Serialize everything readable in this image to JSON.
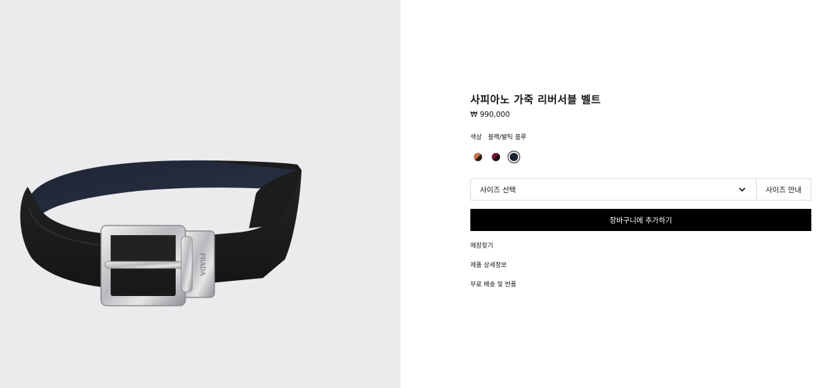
{
  "product": {
    "image_alt": "PRADA",
    "title": "사피아노 가죽 리버서블 벨트",
    "price": "₩ 990,000"
  },
  "color": {
    "label": "색상",
    "value": "블랙/발틱 블루",
    "swatches": [
      {
        "name": "brown-black",
        "color_a": "#c2744f",
        "color_b": "#2a1d1a",
        "selected": false
      },
      {
        "name": "burgundy-black",
        "color_a": "#7a1530",
        "color_b": "#1a1013",
        "selected": false
      },
      {
        "name": "black-baltic-blue",
        "color_a": "#1b2335",
        "color_b": "#1b2335",
        "selected": true
      }
    ]
  },
  "size": {
    "select_label": "사이즈 선택",
    "guide_label": "사이즈 안내"
  },
  "cart": {
    "label": "장바구니에 추가하기"
  },
  "links": {
    "store": "매장찾기",
    "details": "제품 상세정보",
    "shipping": "무료 배송 및 반품"
  }
}
